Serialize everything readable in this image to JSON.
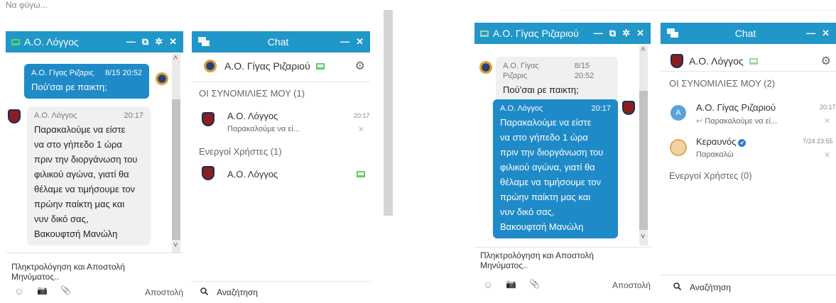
{
  "top_cut_text": "Να φύγω...",
  "left": {
    "conv": {
      "title": "Α.Ο. Λόγγος",
      "msg_out": {
        "sender": "Α.Ο. Γίγας Ριζαρις",
        "time": "8/15 20:52",
        "text": "Πού'σαι ρε παικτη;"
      },
      "msg_in": {
        "sender": "Α.Ο. Λόγγος",
        "time": "20:17",
        "lines": [
          "Παρακαλούμε να είστε",
          "να στο γήπεδο 1 ώρα",
          "πριν την διοργάνωση του",
          "φιλικού αγώνα, γιατί θα",
          "θέλαμε να τιμήσουμε τον",
          "πρώην παίκτη μας και",
          "νυν δικό σας,",
          "Βακουφτσή Μανώλη"
        ]
      },
      "composer_placeholder_1": "Πληκτρολόγηση και Αποστολή",
      "composer_placeholder_2": "Μηνύματος..",
      "send_label": "Αποστολή"
    },
    "chat": {
      "title": "Chat",
      "user": "Α.Ο. Γίγας Ριζαριού",
      "section_conversations": "ΟΙ ΣΥΝΟΜΙΛΙΕΣ ΜΟΥ (1)",
      "conversations": [
        {
          "name": "Α.Ο. Λόγγος",
          "preview": "Παρακαλούμε να εί...",
          "time": "20:17"
        }
      ],
      "section_active": "Ενεργοί Χρήστες (1)",
      "active_users": [
        {
          "name": "Α.Ο. Λόγγος"
        }
      ],
      "search_label": "Αναζήτηση"
    }
  },
  "right": {
    "conv": {
      "title": "Α.Ο. Γίγας Ριζαριού",
      "msg_in": {
        "sender": "Α.Ο. Γίγας Ριζαρις",
        "time": "8/15 20:52",
        "text": "Πού'σαι ρε παικτη;"
      },
      "msg_out": {
        "sender": "Α.Ο. Λόγγος",
        "time": "20:17",
        "lines": [
          "Παρακαλούμε να είστε",
          "να στο γήπεδο 1 ώρα",
          "πριν την διοργάνωση του",
          "φιλικού αγώνα, γιατί θα",
          "θέλαμε να τιμήσουμε τον",
          "πρώην παίκτη μας και",
          "νυν δικό σας,",
          "Βακουφτσή Μανώλη"
        ]
      },
      "composer_placeholder_1": "Πληκτρολόγηση και Αποστολή",
      "composer_placeholder_2": "Μηνύματος..",
      "send_label": "Αποστολή"
    },
    "chat": {
      "title": "Chat",
      "user": "Α.Ο. Λόγγος",
      "section_conversations": "ΟΙ ΣΥΝΟΜΙΛΙΕΣ ΜΟΥ (2)",
      "conversations": [
        {
          "avatar": "A",
          "name": "Α.Ο. Γίγας Ριζαριού",
          "preview": "Παρακαλούμε να εί...",
          "time": "20:17"
        },
        {
          "name": "Κεραυνός",
          "preview": "Παρακαλώ",
          "time": "7/24 23:55"
        }
      ],
      "section_active": "Ενεργοί Χρήστες (0)",
      "search_label": "Αναζήτηση"
    }
  },
  "icons": {
    "minimize": "—",
    "popout": "⧉",
    "settings": "✲",
    "close": "✕",
    "gear": "⚙",
    "search": "🔍",
    "smile": "☺",
    "camera": "📷",
    "paperclip": "📎",
    "reply": "↩",
    "chevron_up": "˄",
    "chevron_down": "˅",
    "check": "✔"
  },
  "colors": {
    "header": "#2196c9",
    "bubble_out": "#1f8ac8",
    "online": "#5fd15f"
  }
}
